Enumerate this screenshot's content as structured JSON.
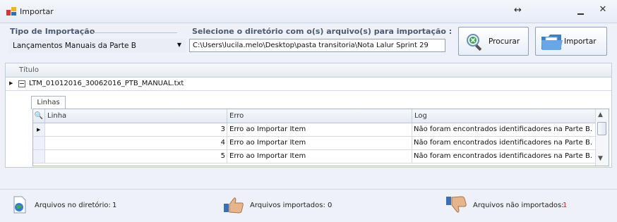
{
  "window": {
    "title": "Importar"
  },
  "form": {
    "tipo_label": "Tipo de Importação",
    "tipo_value": "Lançamentos Manuais da Parte B",
    "dir_label": "Selecione o diretório com o(s) arquivo(s) para importação :",
    "dir_value": "C:\\Users\\lucila.melo\\Desktop\\pasta transitoria\\Nota Lalur Sprint 29",
    "procurar_label": "Procurar",
    "importar_label": "Importar"
  },
  "grid": {
    "header": "Título",
    "file_name": "LTM_01012016_30062016_PTB_MANUAL.txt",
    "tab": "Linhas",
    "columns": [
      "Linha",
      "Erro",
      "Log"
    ],
    "rows": [
      {
        "linha": "3",
        "erro": "Erro ao Importar Item",
        "log": "Não foram encontrados identificadores na Parte B."
      },
      {
        "linha": "4",
        "erro": "Erro ao Importar Item",
        "log": "Não foram encontrados identificadores na Parte B."
      },
      {
        "linha": "5",
        "erro": "Erro ao Importar Item",
        "log": "Não foram encontrados identificadores na Parte B."
      }
    ]
  },
  "footer": {
    "dir_label": "Arquivos no diretório:",
    "dir_count": "1",
    "ok_label": "Arquivos importados: 0",
    "fail_label": "Arquivos não importados:",
    "fail_count": "1"
  },
  "colors": {
    "error_count": "#d21b1b",
    "header_text": "#4a5a70"
  }
}
